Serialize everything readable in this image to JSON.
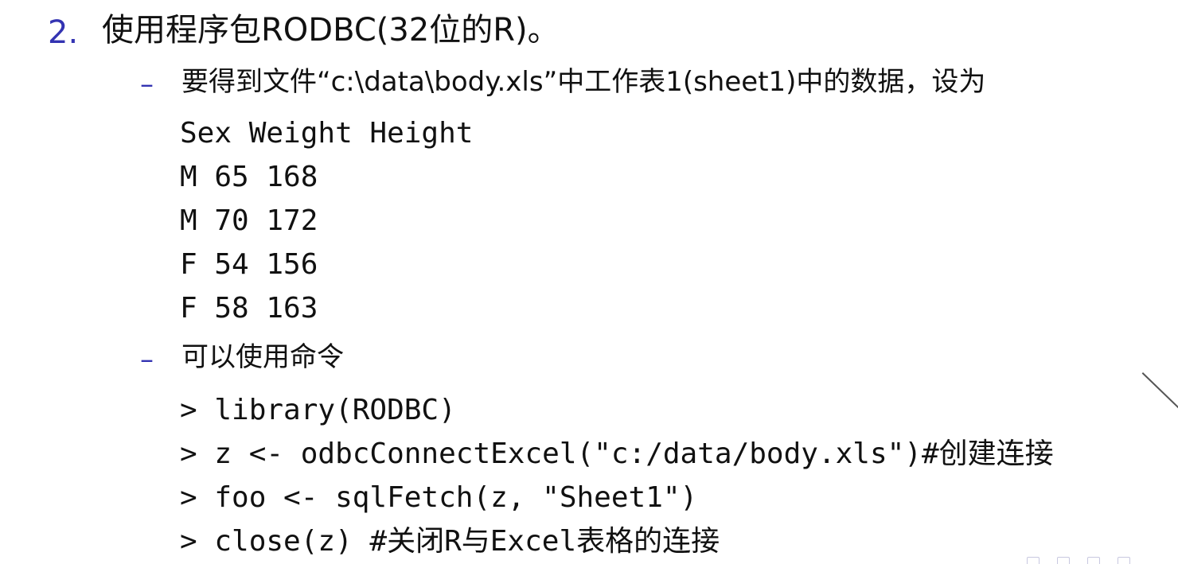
{
  "item": {
    "number": "2.",
    "text": "使用程序包RODBC(32位的R)。"
  },
  "subitems": [
    {
      "dash": "–",
      "text": "要得到文件“c:\\data\\body.xls”中工作表1(sheet1)中的数据，设为"
    },
    {
      "dash": "–",
      "text": "可以使用命令"
    }
  ],
  "data_table": [
    "Sex Weight Height",
    "M 65 168",
    "M 70 172",
    "F 54 156",
    "F 58 163"
  ],
  "code_lines": [
    "> library(RODBC)",
    "> z <- odbcConnectExcel(\"c:/data/body.xls\")#创建连接",
    "> foo <- sqlFetch(z, \"Sheet1\")",
    "> close(z) #关闭R与Excel表格的连接"
  ],
  "colors": {
    "accent": "#3333b2",
    "text": "#111111",
    "background": "#ffffff"
  },
  "icons": [
    "nav-icon",
    "pen-line-icon"
  ]
}
